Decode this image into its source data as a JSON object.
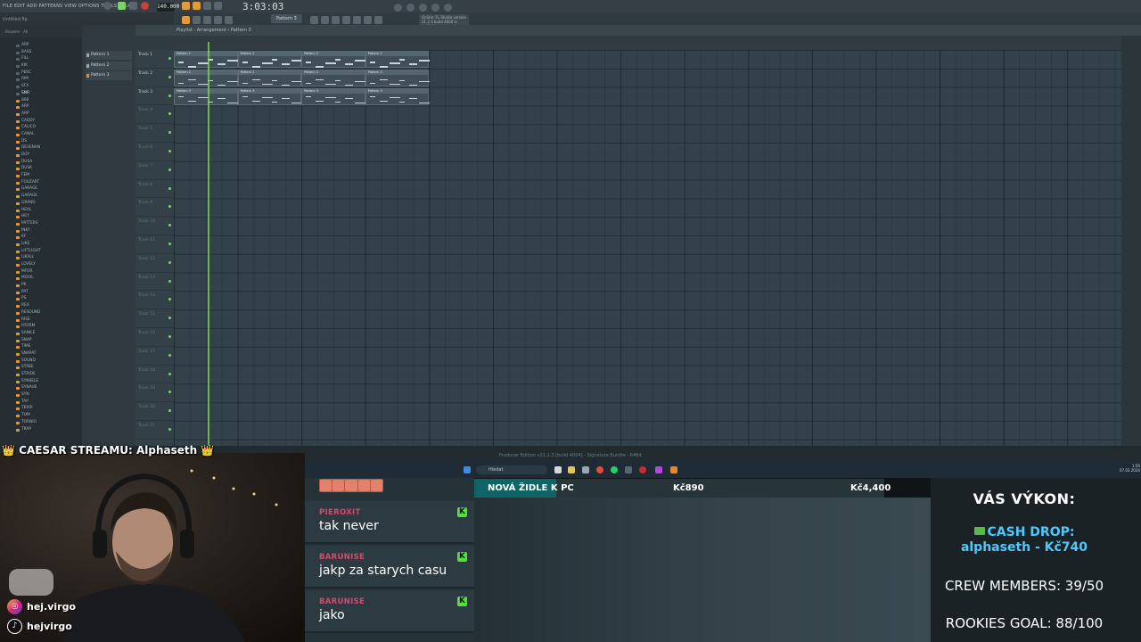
{
  "fl": {
    "menu": "FILE EDIT ADD PATTERNS VIEW OPTIONS TOOLS HELP",
    "hint_left": "Untitled.flp",
    "tempo": "140.000",
    "time": "3:03:03",
    "pattern_selector": "Pattern 3",
    "news": "Online: FL Studio version 21.2.3 build 4004 is available",
    "browser_header": "Browser - All",
    "playlist_title": "Playlist - Arrangement › Pattern 3",
    "hint_bottom": "Producer Edition v21.2.3 [build 4004] - Signature Bundle - 64Bit",
    "browser_top_items": [
      "ARP",
      "BASS",
      "FILL",
      "KIK",
      "PERC",
      "RIM",
      "SFX",
      "SNR"
    ],
    "browser_items": [
      "808",
      "ARP",
      "ARP",
      "CADDY",
      "CALICO",
      "CANAL",
      "DS",
      "DEVENAN",
      "DOY",
      "DUSA",
      "DUSK",
      "FEM",
      "FOUZART",
      "GARAGE",
      "GARAGE",
      "GRAND",
      "HEAL",
      "HEY",
      "PATTERS",
      "INKY",
      "KF",
      "LIKE",
      "LIFTLIGHT",
      "LIKALL",
      "LOVELY",
      "MFOR",
      "MOVIL",
      "PK",
      "PAT",
      "PS",
      "REX",
      "RESOUND",
      "RISE",
      "RYDRM",
      "SANILE",
      "SNAP",
      "TIME",
      "SNAPAT",
      "SOUND",
      "STREE",
      "STRIDE",
      "SYNSELE",
      "SYNAUE",
      "SYN",
      "TAP",
      "TERRI",
      "TOM",
      "TORNIO",
      "TRAP"
    ],
    "patterns": [
      "Pattern 1",
      "Pattern 2",
      "Pattern 3"
    ],
    "tracks": [
      "Track 1",
      "Track 2",
      "Track 3",
      "Track 4",
      "Track 5",
      "Track 6",
      "Track 7",
      "Track 8",
      "Track 9",
      "Track 10",
      "Track 11",
      "Track 12",
      "Track 13",
      "Track 14",
      "Track 15",
      "Track 16",
      "Track 17",
      "Track 18",
      "Track 19",
      "Track 20",
      "Track 21"
    ],
    "clips": [
      {
        "track": 1,
        "bar": 1,
        "label": "Pattern 1"
      },
      {
        "track": 1,
        "bar": 5,
        "label": "Pattern 2"
      },
      {
        "track": 1,
        "bar": 9,
        "label": "Pattern 2"
      },
      {
        "track": 1,
        "bar": 13,
        "label": "Pattern 2"
      },
      {
        "track": 2,
        "bar": 1,
        "label": "Pattern 2"
      },
      {
        "track": 2,
        "bar": 5,
        "label": "Pattern 2"
      },
      {
        "track": 2,
        "bar": 9,
        "label": "Pattern 2"
      },
      {
        "track": 2,
        "bar": 13,
        "label": "Pattern 2"
      },
      {
        "track": 3,
        "bar": 1,
        "label": "Pattern 3"
      },
      {
        "track": 3,
        "bar": 5,
        "label": "Pattern 3"
      },
      {
        "track": 3,
        "bar": 9,
        "label": "Pattern 3"
      },
      {
        "track": 3,
        "bar": 13,
        "label": "Pattern 3"
      }
    ]
  },
  "taskbar": {
    "search_placeholder": "Hledat",
    "time": "1:59",
    "date": "07.03.2024"
  },
  "overlay": {
    "caesar": "CAESAR STREAMU: Alphaseth",
    "crown": "👑",
    "instagram": "hej.virgo",
    "tiktok": "hejvirgo",
    "chat": [
      {
        "user": "PIEROXIT",
        "text": "tak never"
      },
      {
        "user": "BARUNISE",
        "text": "jakp za starych casu"
      },
      {
        "user": "BARUNISE",
        "text": "jako"
      }
    ],
    "goal": {
      "label": "NOVÁ ŽIDLE K PC",
      "current": "Kč890",
      "target": "Kč4,400",
      "progress": 0.2
    },
    "stats": {
      "title": "VÁS VÝKON:",
      "cash_drop_label": "CASH DROP:",
      "cash_drop_value": "alphaseth - Kč740",
      "crew": "CREW MEMBERS: 39/50",
      "rookies": "ROOKIES GOAL: 88/100"
    }
  },
  "colors": {
    "accent_orange": "#e39a3a",
    "kick_green": "#53e03a",
    "chat_user": "#d9496a",
    "cash_drop": "#4ec9ff"
  }
}
